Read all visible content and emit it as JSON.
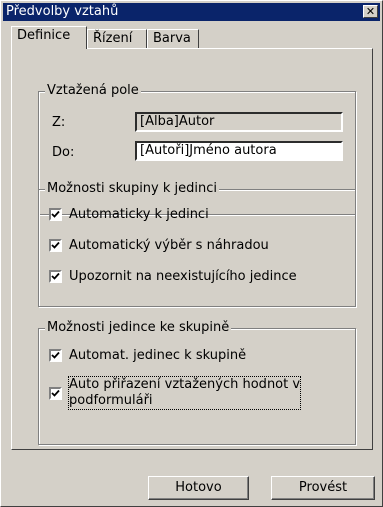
{
  "window": {
    "title": "Předvolby vztahů",
    "close_label": "✕"
  },
  "tabs": [
    {
      "label": "Definice"
    },
    {
      "label": "Řízení"
    },
    {
      "label": "Barva"
    }
  ],
  "related_field": {
    "title": "Vztažená pole",
    "from_label": "Z:",
    "from_value": "[Alba]Autor",
    "to_label": "Do:",
    "to_value": "[Autoři]Jméno autora"
  },
  "group_to_individual": {
    "title": "Možnosti skupiny k jedinci",
    "options": [
      {
        "label": "Automaticky k jedinci",
        "checked": true
      },
      {
        "label": "Automatický výběr s náhradou",
        "checked": true
      },
      {
        "label": "Upozornit na neexistujícího jedince",
        "checked": true
      }
    ]
  },
  "individual_to_group": {
    "title": "Možnosti jedince ke skupině",
    "options": [
      {
        "label": "Automat. jedinec k skupině",
        "checked": true
      },
      {
        "label_line1": "Auto přiřazení vztažených hodnot v",
        "label_line2": "podformuláři",
        "checked": true
      }
    ]
  },
  "buttons": {
    "done": "Hotovo",
    "execute": "Provést"
  }
}
